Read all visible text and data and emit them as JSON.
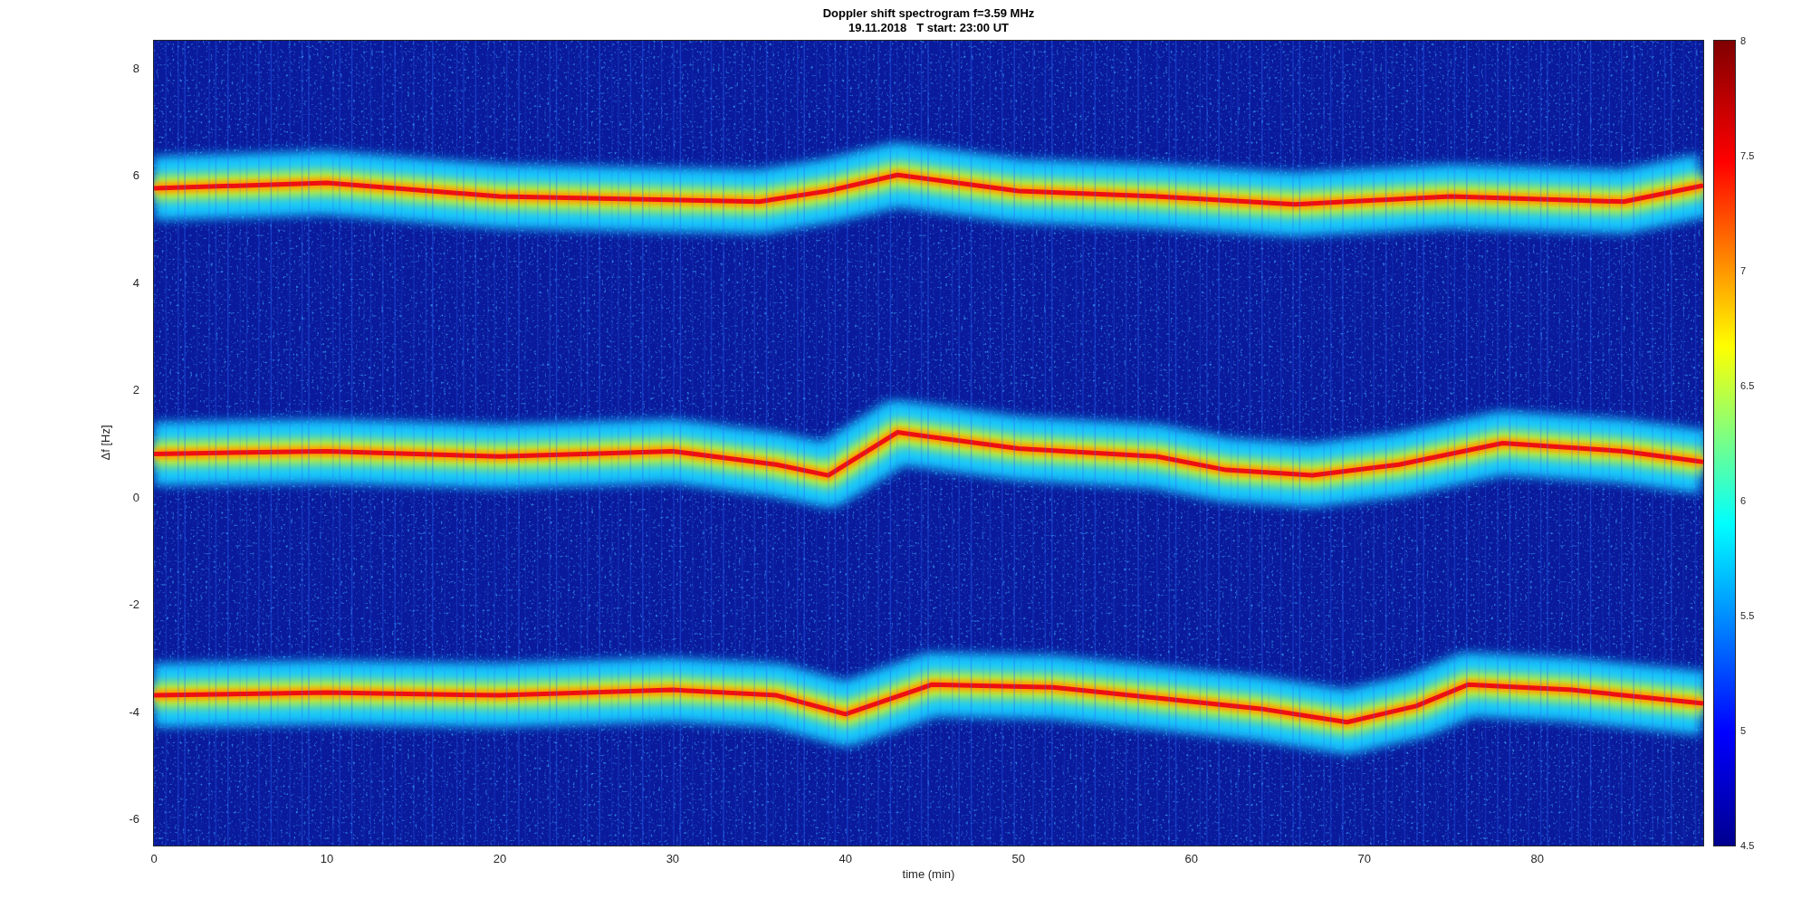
{
  "figure": {
    "title": "Doppler shift spectrogram f=3.59 MHz",
    "subtitle": "19.11.2018   T start: 23:00 UT"
  },
  "axes": {
    "ylabel": "Δf [Hz]",
    "xlabel": "time (min)",
    "yticks": [
      "8",
      "6",
      "4",
      "2",
      "0",
      "-2",
      "-4",
      "-6"
    ],
    "xticks": [
      "0",
      "10",
      "20",
      "30",
      "40",
      "50",
      "60",
      "70",
      "80"
    ]
  },
  "colorbar": {
    "ticks": [
      "8",
      "7.5",
      "7",
      "6.5",
      "6",
      "5.5",
      "5",
      "4.5"
    ]
  }
}
